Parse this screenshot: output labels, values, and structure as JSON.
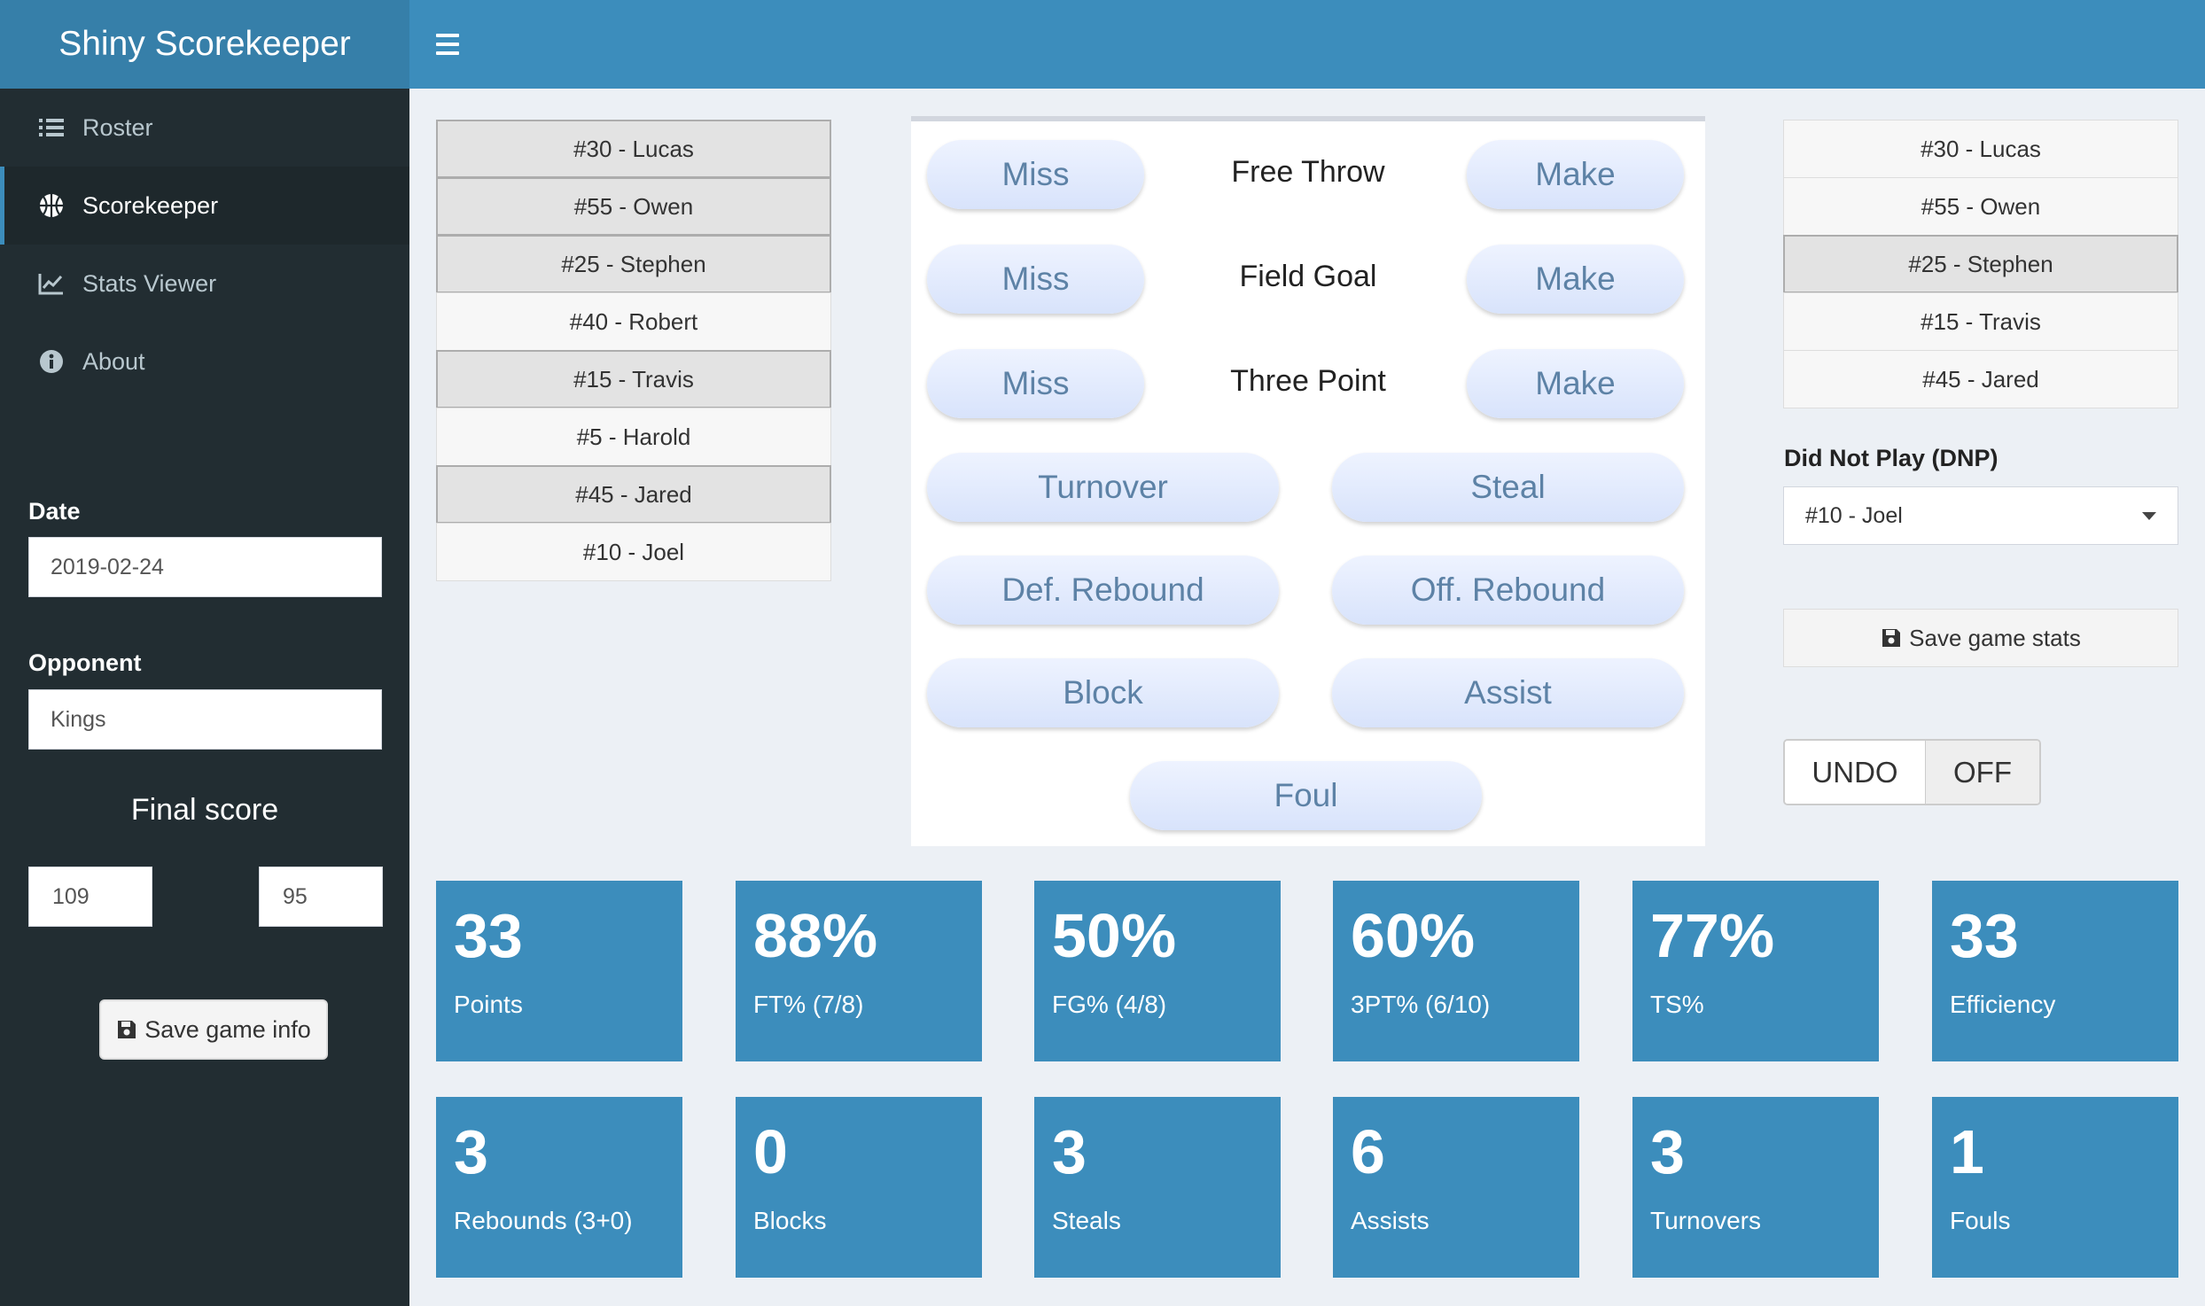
{
  "header": {
    "brand": "Shiny Scorekeeper",
    "menu_icon": "hamburger-icon"
  },
  "sidebar": {
    "items": [
      {
        "label": "Roster",
        "icon": "list-icon"
      },
      {
        "label": "Scorekeeper",
        "icon": "basketball-icon"
      },
      {
        "label": "Stats Viewer",
        "icon": "line-chart-icon"
      },
      {
        "label": "About",
        "icon": "info-circle-icon"
      }
    ],
    "date_label": "Date",
    "date_value": "2019-02-24",
    "opponent_label": "Opponent",
    "opponent_value": "Kings",
    "final_score_label": "Final score",
    "score_us": "109",
    "score_them": "95",
    "save_info_label": "Save game info"
  },
  "left_players": [
    {
      "label": "#30 - Lucas",
      "state": "active"
    },
    {
      "label": "#55 - Owen",
      "state": "active"
    },
    {
      "label": "#25 - Stephen",
      "state": "active"
    },
    {
      "label": "#40 - Robert",
      "state": "inactive"
    },
    {
      "label": "#15 - Travis",
      "state": "active"
    },
    {
      "label": "#5 - Harold",
      "state": "inactive"
    },
    {
      "label": "#45 - Jared",
      "state": "active"
    },
    {
      "label": "#10 - Joel",
      "state": "inactive"
    }
  ],
  "buttons": {
    "free_throw": {
      "label": "Free Throw",
      "miss": "Miss",
      "make": "Make"
    },
    "field_goal": {
      "label": "Field Goal",
      "miss": "Miss",
      "make": "Make"
    },
    "three_point": {
      "label": "Three Point",
      "miss": "Miss",
      "make": "Make"
    },
    "turnover": "Turnover",
    "steal": "Steal",
    "def_rebound": "Def. Rebound",
    "off_rebound": "Off. Rebound",
    "block": "Block",
    "assist": "Assist",
    "foul": "Foul"
  },
  "right_players": [
    {
      "label": "#30 - Lucas",
      "state": "inactive"
    },
    {
      "label": "#55 - Owen",
      "state": "inactive"
    },
    {
      "label": "#25 - Stephen",
      "state": "active"
    },
    {
      "label": "#15 - Travis",
      "state": "inactive"
    },
    {
      "label": "#45 - Jared",
      "state": "inactive"
    }
  ],
  "dnp": {
    "label": "Did Not Play (DNP)",
    "selected": "#10 - Joel"
  },
  "save_stats_label": "Save game stats",
  "undo_toggle": {
    "label": "UNDO",
    "state": "OFF"
  },
  "stats_row1": [
    {
      "value": "33",
      "label": "Points"
    },
    {
      "value": "88%",
      "label": "FT% (7/8)"
    },
    {
      "value": "50%",
      "label": "FG% (4/8)"
    },
    {
      "value": "60%",
      "label": "3PT% (6/10)"
    },
    {
      "value": "77%",
      "label": "TS%"
    },
    {
      "value": "33",
      "label": "Efficiency"
    }
  ],
  "stats_row2": [
    {
      "value": "3",
      "label": "Rebounds (3+0)"
    },
    {
      "value": "0",
      "label": "Blocks"
    },
    {
      "value": "3",
      "label": "Steals"
    },
    {
      "value": "6",
      "label": "Assists"
    },
    {
      "value": "3",
      "label": "Turnovers"
    },
    {
      "value": "1",
      "label": "Fouls"
    }
  ],
  "colors": {
    "header": "#3c8dbc",
    "brand": "#367fa9",
    "sidebar": "#222d32",
    "stat_box": "#3c8dbc"
  }
}
